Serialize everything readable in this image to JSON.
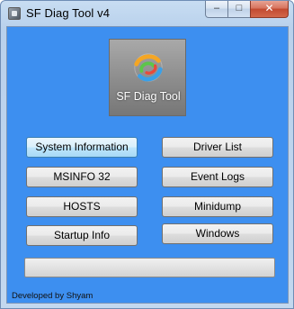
{
  "window": {
    "title": "SF Diag Tool v4",
    "minimize_glyph": "–",
    "maximize_glyph": "□",
    "close_glyph": "✕"
  },
  "logo": {
    "text": "SF Diag Tool",
    "icon": "swirl-logo-icon"
  },
  "buttons": {
    "system_information": "System Information",
    "driver_list": "Driver List",
    "msinfo32": "MSINFO 32",
    "event_logs": "Event Logs",
    "hosts": "HOSTS",
    "minidump": "Minidump",
    "startup_info": "Startup Info",
    "windows": "Windows"
  },
  "progress": {
    "percent": 0
  },
  "footer": {
    "text": "Developed by Shyam"
  },
  "colors": {
    "client_background": "#3d8ff0",
    "close_button": "#c24a31"
  }
}
